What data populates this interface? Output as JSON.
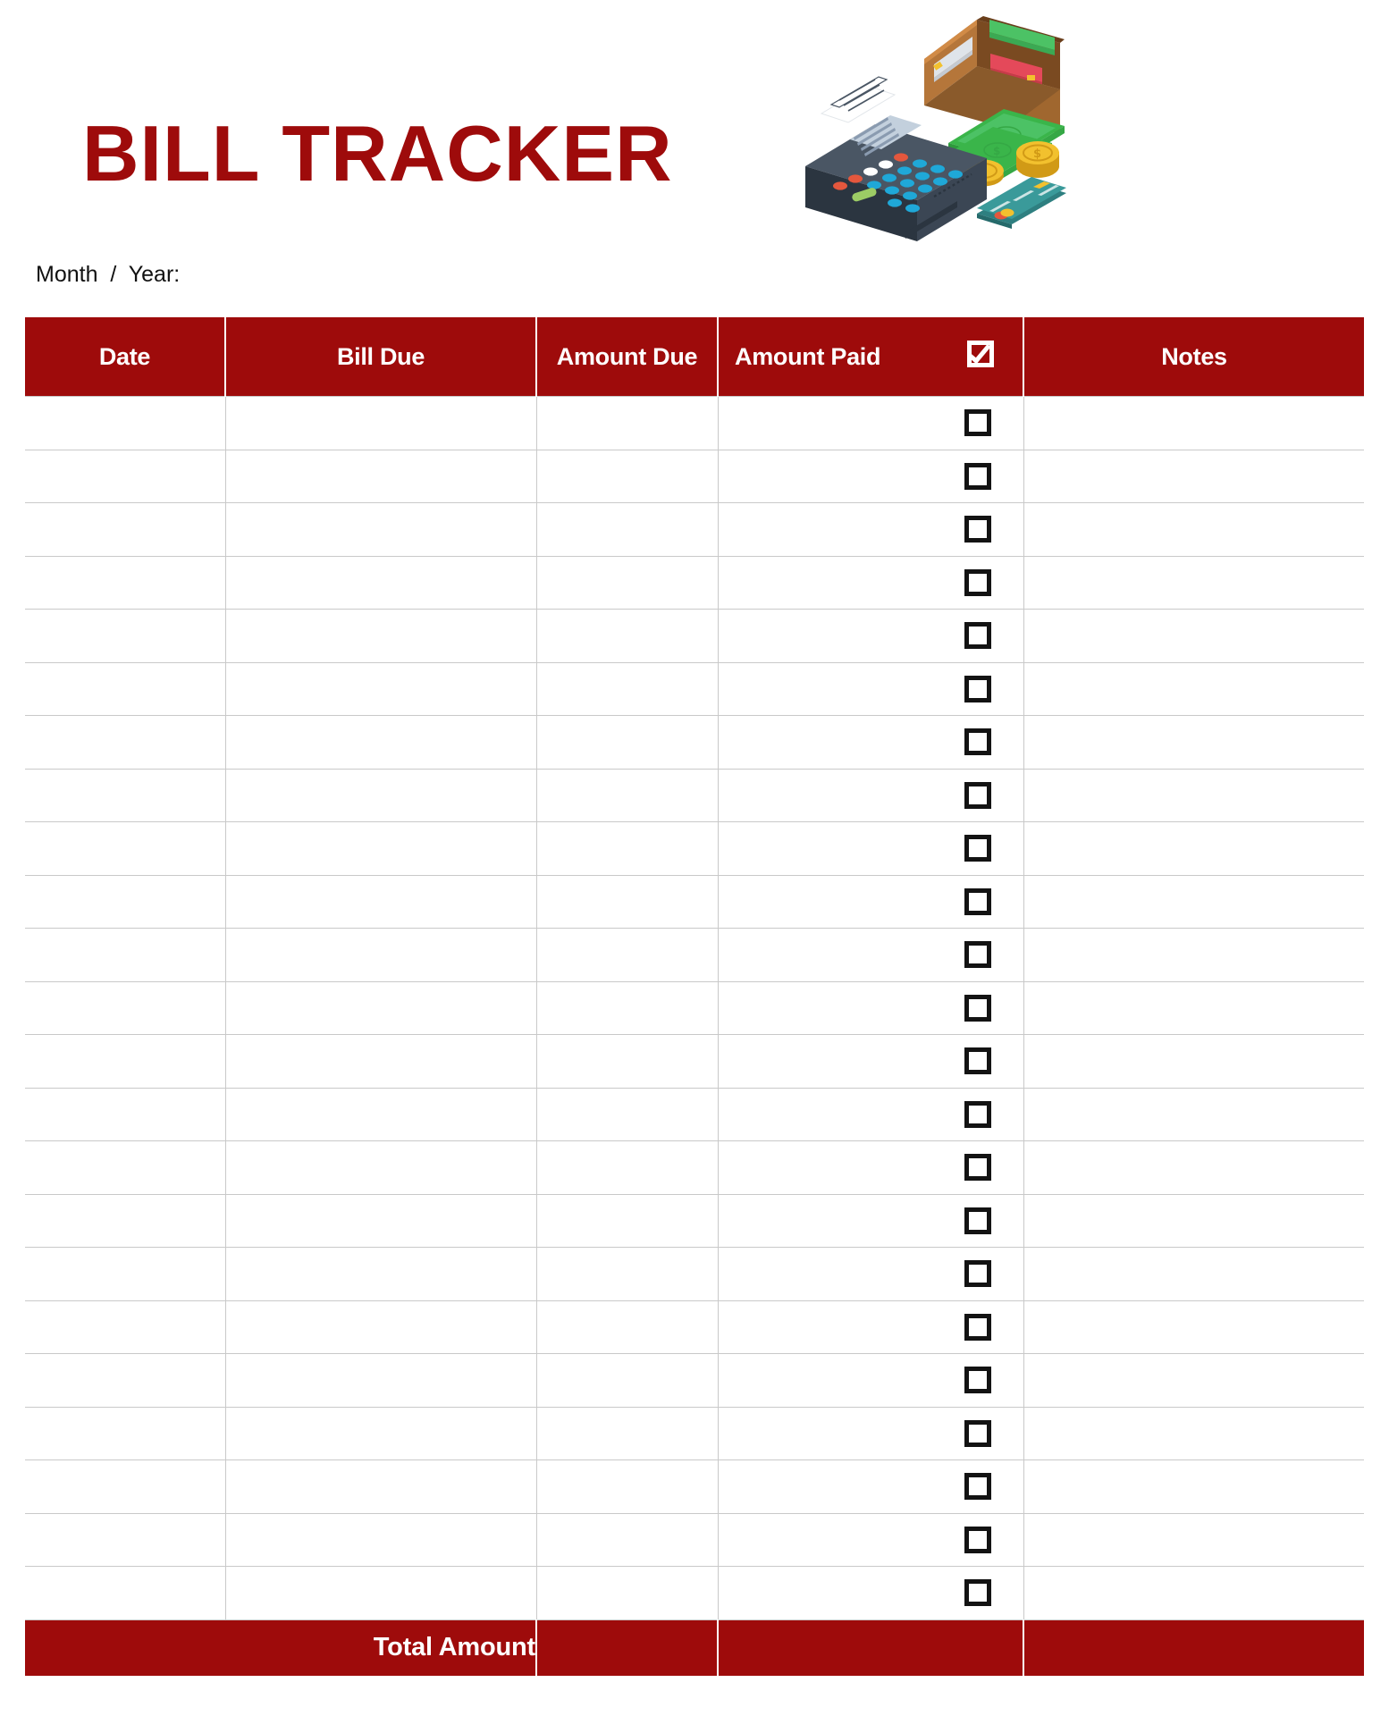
{
  "page": {
    "title": "BILL TRACKER",
    "month_year_label": "Month  /  Year:",
    "title_color": "#9e0b0b",
    "header_bg_color": "#9e0b0b",
    "grid_line_color": "#c9c9c9"
  },
  "illustration": {
    "name": "payment-illustration",
    "elements": [
      "pos-terminal-icon",
      "receipt-paper-icon",
      "wallet-icon",
      "banknotes-icon",
      "coins-icon",
      "credit-card-icon"
    ],
    "colors": {
      "terminal": "#3b4654",
      "terminal_dark": "#2b3540",
      "keypad_blue": "#1fa8d8",
      "keypad_green": "#9ccc65",
      "keypad_red": "#e4573d",
      "wallet_brown": "#a0672f",
      "wallet_brown_dark": "#7a4a21",
      "money_green": "#3ab54a",
      "coin_gold": "#f2c12e",
      "card_teal": "#3a9a9a"
    }
  },
  "table": {
    "columns": [
      {
        "key": "date",
        "label": "Date"
      },
      {
        "key": "bill_due",
        "label": "Bill Due"
      },
      {
        "key": "amount_due",
        "label": "Amount Due"
      },
      {
        "key": "amount_paid",
        "label": "Amount Paid"
      },
      {
        "key": "notes",
        "label": "Notes"
      }
    ],
    "paid_checkbox_icon": "checked-checkbox-icon",
    "row_count": 23,
    "rows": [
      {
        "date": "",
        "bill_due": "",
        "amount_due": "",
        "amount_paid": "",
        "paid": false,
        "notes": ""
      },
      {
        "date": "",
        "bill_due": "",
        "amount_due": "",
        "amount_paid": "",
        "paid": false,
        "notes": ""
      },
      {
        "date": "",
        "bill_due": "",
        "amount_due": "",
        "amount_paid": "",
        "paid": false,
        "notes": ""
      },
      {
        "date": "",
        "bill_due": "",
        "amount_due": "",
        "amount_paid": "",
        "paid": false,
        "notes": ""
      },
      {
        "date": "",
        "bill_due": "",
        "amount_due": "",
        "amount_paid": "",
        "paid": false,
        "notes": ""
      },
      {
        "date": "",
        "bill_due": "",
        "amount_due": "",
        "amount_paid": "",
        "paid": false,
        "notes": ""
      },
      {
        "date": "",
        "bill_due": "",
        "amount_due": "",
        "amount_paid": "",
        "paid": false,
        "notes": ""
      },
      {
        "date": "",
        "bill_due": "",
        "amount_due": "",
        "amount_paid": "",
        "paid": false,
        "notes": ""
      },
      {
        "date": "",
        "bill_due": "",
        "amount_due": "",
        "amount_paid": "",
        "paid": false,
        "notes": ""
      },
      {
        "date": "",
        "bill_due": "",
        "amount_due": "",
        "amount_paid": "",
        "paid": false,
        "notes": ""
      },
      {
        "date": "",
        "bill_due": "",
        "amount_due": "",
        "amount_paid": "",
        "paid": false,
        "notes": ""
      },
      {
        "date": "",
        "bill_due": "",
        "amount_due": "",
        "amount_paid": "",
        "paid": false,
        "notes": ""
      },
      {
        "date": "",
        "bill_due": "",
        "amount_due": "",
        "amount_paid": "",
        "paid": false,
        "notes": ""
      },
      {
        "date": "",
        "bill_due": "",
        "amount_due": "",
        "amount_paid": "",
        "paid": false,
        "notes": ""
      },
      {
        "date": "",
        "bill_due": "",
        "amount_due": "",
        "amount_paid": "",
        "paid": false,
        "notes": ""
      },
      {
        "date": "",
        "bill_due": "",
        "amount_due": "",
        "amount_paid": "",
        "paid": false,
        "notes": ""
      },
      {
        "date": "",
        "bill_due": "",
        "amount_due": "",
        "amount_paid": "",
        "paid": false,
        "notes": ""
      },
      {
        "date": "",
        "bill_due": "",
        "amount_due": "",
        "amount_paid": "",
        "paid": false,
        "notes": ""
      },
      {
        "date": "",
        "bill_due": "",
        "amount_due": "",
        "amount_paid": "",
        "paid": false,
        "notes": ""
      },
      {
        "date": "",
        "bill_due": "",
        "amount_due": "",
        "amount_paid": "",
        "paid": false,
        "notes": ""
      },
      {
        "date": "",
        "bill_due": "",
        "amount_due": "",
        "amount_paid": "",
        "paid": false,
        "notes": ""
      },
      {
        "date": "",
        "bill_due": "",
        "amount_due": "",
        "amount_paid": "",
        "paid": false,
        "notes": ""
      },
      {
        "date": "",
        "bill_due": "",
        "amount_due": "",
        "amount_paid": "",
        "paid": false,
        "notes": ""
      }
    ],
    "footer": {
      "total_label": "Total Amount",
      "total_amount_due": "",
      "total_amount_paid": "",
      "total_notes": ""
    }
  }
}
